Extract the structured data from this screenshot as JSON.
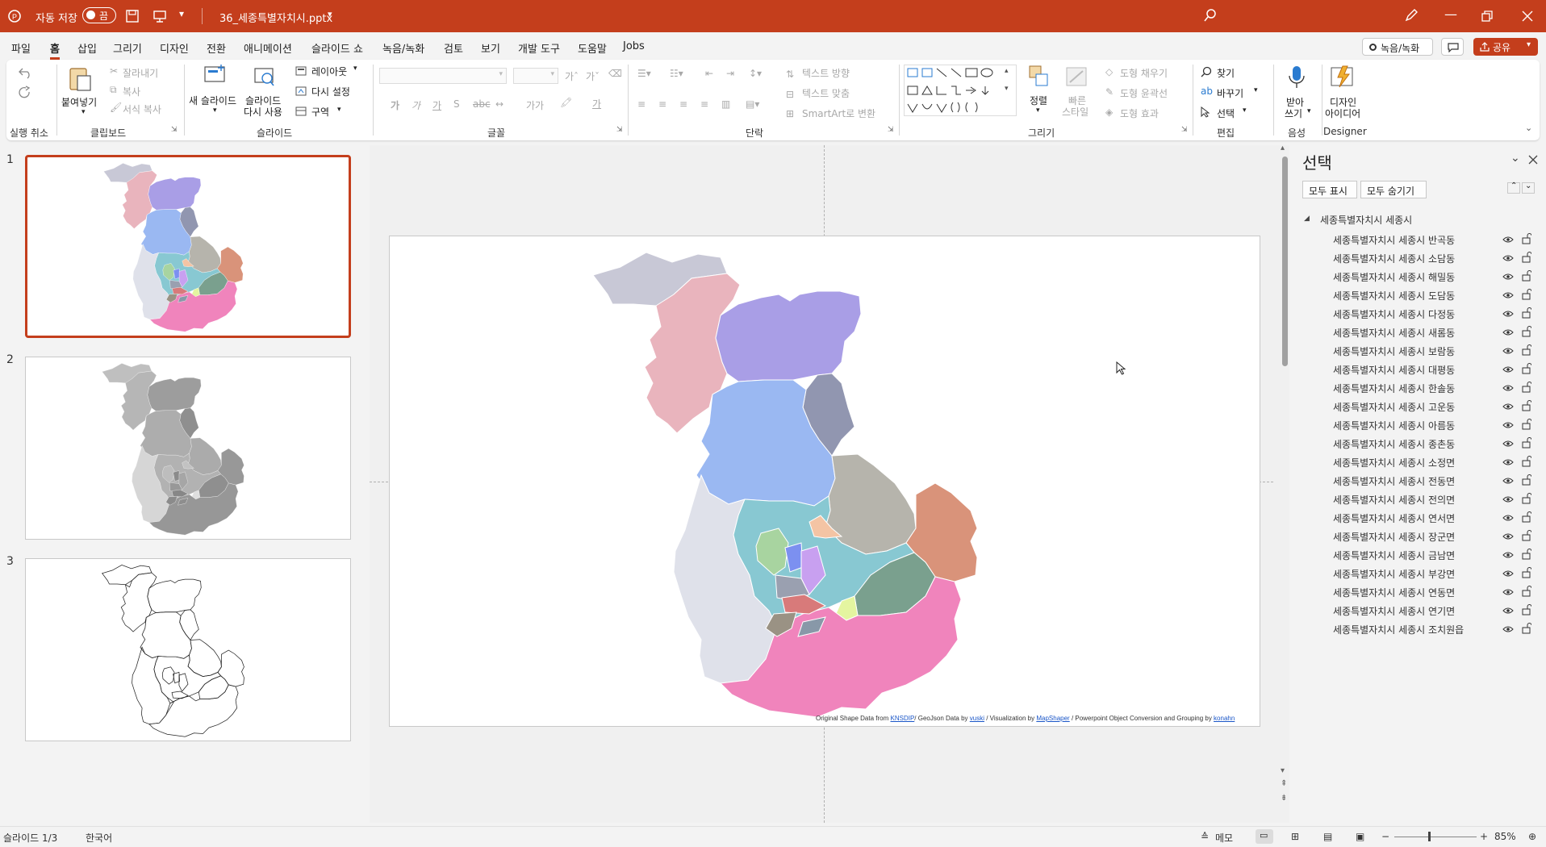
{
  "titlebar": {
    "autosave_label": "자동 저장",
    "autosave_state": "끔",
    "filename": "36_세종특별자치시.pptx"
  },
  "menu": [
    "파일",
    "홈",
    "삽입",
    "그리기",
    "디자인",
    "전환",
    "애니메이션",
    "슬라이드 쇼",
    "녹음/녹화",
    "검토",
    "보기",
    "개발 도구",
    "도움말",
    "Jobs"
  ],
  "menu_right": {
    "record": "녹음/녹화",
    "share": "공유"
  },
  "ribbon": {
    "undo_group": "실행 취소",
    "clipboard": {
      "paste": "붙여넣기",
      "cut": "잘라내기",
      "copy": "복사",
      "format_copy": "서식 복사",
      "group": "클립보드"
    },
    "slides": {
      "new": "새 슬라이드",
      "reuse_line1": "슬라이드",
      "reuse_line2": "다시 사용",
      "layout": "레이아웃",
      "reset": "다시 설정",
      "section": "구역",
      "group": "슬라이드"
    },
    "font": {
      "group": "글꼴"
    },
    "paragraph": {
      "text_direction": "텍스트 방향",
      "align_text": "텍스트 맞춤",
      "smartart": "SmartArt로 변환",
      "group": "단락"
    },
    "drawing": {
      "arrange": "정렬",
      "quick_styles_line1": "빠른",
      "quick_styles_line2": "스타일",
      "fill": "도형 채우기",
      "outline": "도형 윤곽선",
      "effects": "도형 효과",
      "group": "그리기"
    },
    "editing": {
      "find": "찾기",
      "replace": "바꾸기",
      "select": "선택",
      "group": "편집"
    },
    "voice": {
      "dictate_line1": "받아",
      "dictate_line2": "쓰기",
      "group": "음성"
    },
    "designer": {
      "line1": "디자인",
      "line2": "아이디어",
      "group": "Designer"
    }
  },
  "slides": [
    {
      "number": "1",
      "selected": true
    },
    {
      "number": "2",
      "selected": false
    },
    {
      "number": "3",
      "selected": false
    }
  ],
  "slide_credit": {
    "prefix": "Original Shape Data from ",
    "src1": "KNSDIP",
    "mid1": "/ GeoJson Data by ",
    "src2": "vuski",
    "mid2": " / Visualization  by ",
    "src3": "MapShaper",
    "mid3": " / Powerpoint Object Conversion and Grouping  by ",
    "src4": "konahn"
  },
  "map_colors": {
    "banggok": "#c8c8d6",
    "sodam": "#e9b4bd",
    "haemil": "#a99ee6",
    "dodam": "#9ab8f2",
    "dajeong": "#9196b0",
    "saerom": "#b6b4ac",
    "boram": "#d9937a",
    "west": "#dfe1ea",
    "center": "#88c8d2",
    "south": "#f084bc",
    "green": "#7aa08e",
    "lime": "#e4f5a0",
    "peach": "#f4c4a4",
    "lightgreen": "#a8d4a0",
    "blue": "#7c90f0",
    "purple": "#c8a0f0",
    "red": "#d87a7a",
    "brown": "#9a9284",
    "slate": "#8898a8"
  },
  "selection_pane": {
    "title": "선택",
    "show_all": "모두 표시",
    "hide_all": "모두 숨기기",
    "group_name": "세종특별자치시 세종시",
    "items": [
      "세종특별자치시 세종시 반곡동",
      "세종특별자치시 세종시 소담동",
      "세종특별자치시 세종시 해밀동",
      "세종특별자치시 세종시 도담동",
      "세종특별자치시 세종시 다정동",
      "세종특별자치시 세종시 새롬동",
      "세종특별자치시 세종시 보람동",
      "세종특별자치시 세종시 대평동",
      "세종특별자치시 세종시 한솔동",
      "세종특별자치시 세종시 고운동",
      "세종특별자치시 세종시 아름동",
      "세종특별자치시 세종시 종촌동",
      "세종특별자치시 세종시 소정면",
      "세종특별자치시 세종시 전동면",
      "세종특별자치시 세종시 전의면",
      "세종특별자치시 세종시 연서면",
      "세종특별자치시 세종시 장군면",
      "세종특별자치시 세종시 금남면",
      "세종특별자치시 세종시 부강면",
      "세종특별자치시 세종시 연동면",
      "세종특별자치시 세종시 연기면",
      "세종특별자치시 세종시 조치원읍"
    ]
  },
  "statusbar": {
    "slide_indicator": "슬라이드 1/3",
    "language": "한국어",
    "notes": "메모",
    "zoom": "85%"
  }
}
